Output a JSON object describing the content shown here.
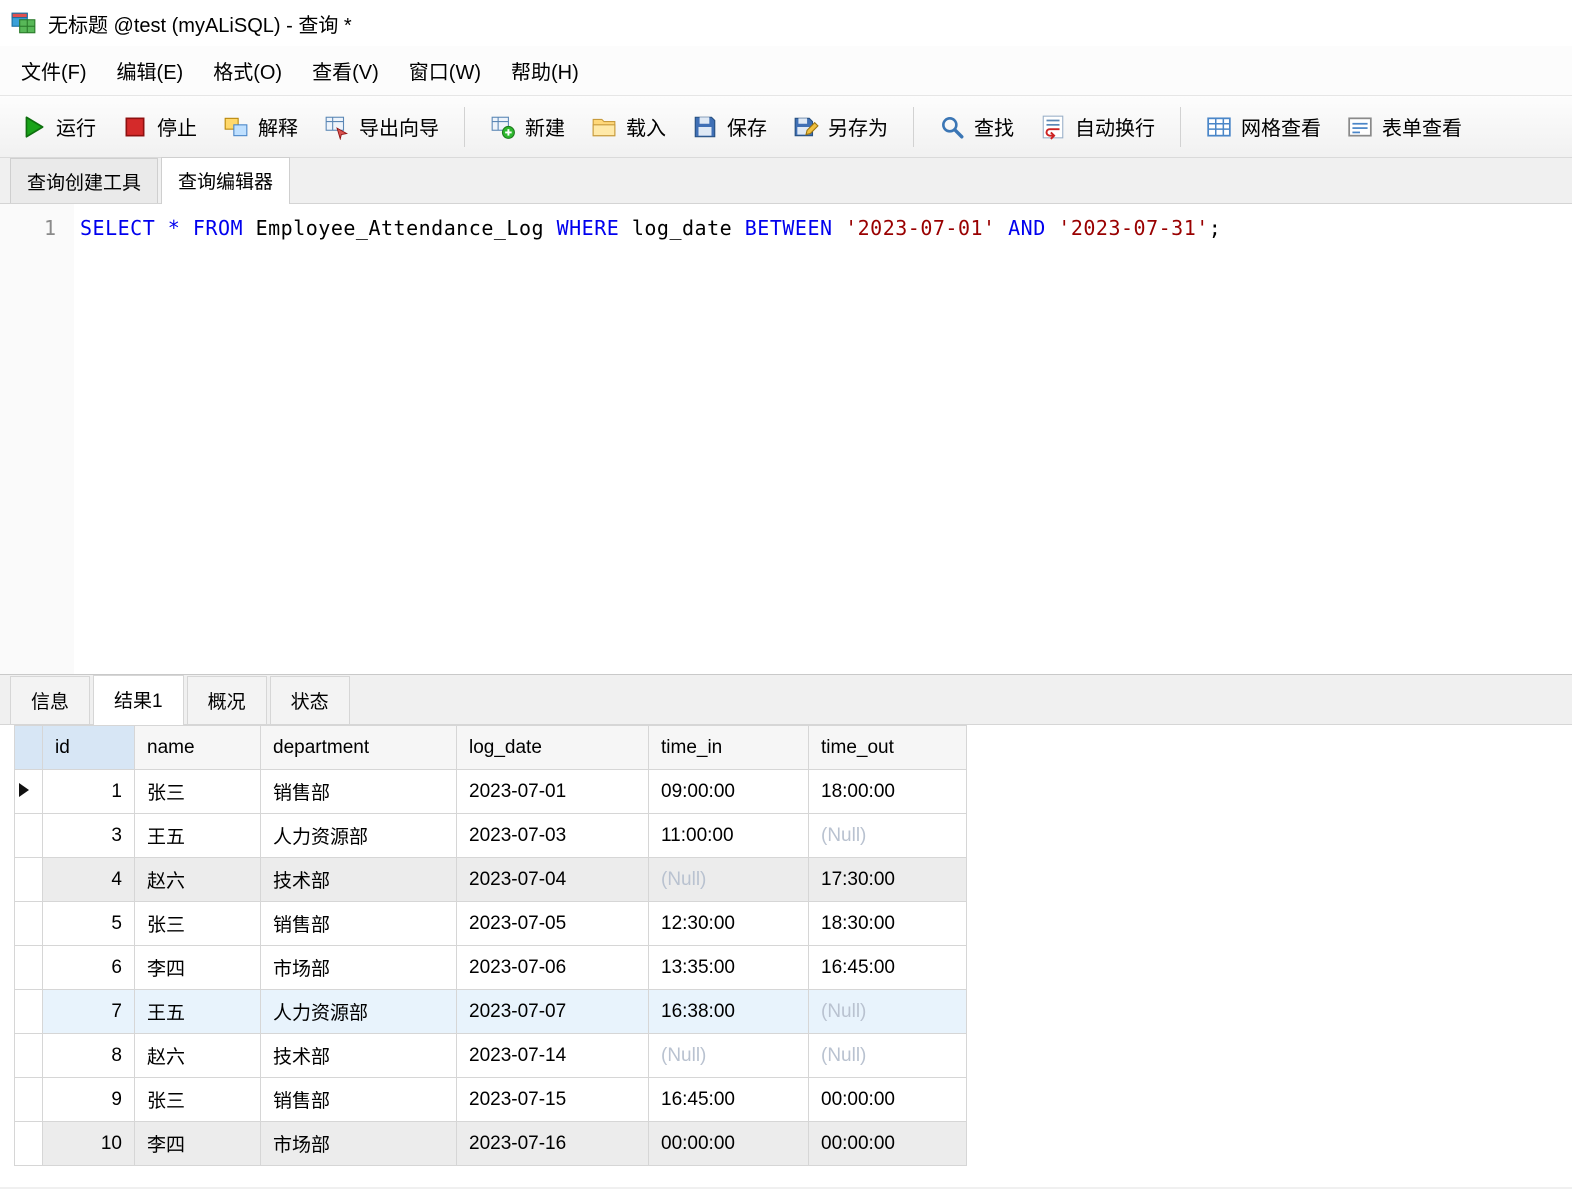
{
  "window": {
    "title": "无标题 @test (myALiSQL) - 查询 *"
  },
  "menubar": {
    "items": [
      {
        "key": "file",
        "label": "文件(F)"
      },
      {
        "key": "edit",
        "label": "编辑(E)"
      },
      {
        "key": "format",
        "label": "格式(O)"
      },
      {
        "key": "view",
        "label": "查看(V)"
      },
      {
        "key": "window",
        "label": "窗口(W)"
      },
      {
        "key": "help",
        "label": "帮助(H)"
      }
    ]
  },
  "toolbar": {
    "groups": [
      {
        "buttons": [
          {
            "key": "run",
            "label": "运行",
            "icon": "run-icon"
          },
          {
            "key": "stop",
            "label": "停止",
            "icon": "stop-icon"
          },
          {
            "key": "explain",
            "label": "解释",
            "icon": "explain-icon"
          },
          {
            "key": "export-wizard",
            "label": "导出向导",
            "icon": "export-wizard-icon"
          }
        ]
      },
      {
        "buttons": [
          {
            "key": "new",
            "label": "新建",
            "icon": "new-icon"
          },
          {
            "key": "load",
            "label": "载入",
            "icon": "load-icon"
          },
          {
            "key": "save",
            "label": "保存",
            "icon": "save-icon"
          },
          {
            "key": "save-as",
            "label": "另存为",
            "icon": "save-as-icon"
          }
        ]
      },
      {
        "buttons": [
          {
            "key": "find",
            "label": "查找",
            "icon": "find-icon"
          },
          {
            "key": "word-wrap",
            "label": "自动换行",
            "icon": "word-wrap-icon"
          }
        ]
      },
      {
        "buttons": [
          {
            "key": "grid-view",
            "label": "网格查看",
            "icon": "grid-view-icon"
          },
          {
            "key": "form-view",
            "label": "表单查看",
            "icon": "form-view-icon"
          }
        ]
      }
    ]
  },
  "query_tabs": [
    {
      "key": "query-builder",
      "label": "查询创建工具",
      "active": false
    },
    {
      "key": "query-editor",
      "label": "查询编辑器",
      "active": true
    }
  ],
  "editor": {
    "line_number": "1",
    "tokens": [
      {
        "type": "kw",
        "text": "SELECT"
      },
      {
        "type": "plain",
        "text": " "
      },
      {
        "type": "kw",
        "text": "*"
      },
      {
        "type": "plain",
        "text": " "
      },
      {
        "type": "kw",
        "text": "FROM"
      },
      {
        "type": "plain",
        "text": " Employee_Attendance_Log "
      },
      {
        "type": "kw",
        "text": "WHERE"
      },
      {
        "type": "plain",
        "text": " log_date "
      },
      {
        "type": "kw",
        "text": "BETWEEN"
      },
      {
        "type": "plain",
        "text": " "
      },
      {
        "type": "str",
        "text": "'2023-07-01'"
      },
      {
        "type": "plain",
        "text": " "
      },
      {
        "type": "kw",
        "text": "AND"
      },
      {
        "type": "plain",
        "text": " "
      },
      {
        "type": "str",
        "text": "'2023-07-31'"
      },
      {
        "type": "plain",
        "text": ";"
      }
    ]
  },
  "result_tabs": [
    {
      "key": "info",
      "label": "信息",
      "active": false
    },
    {
      "key": "result1",
      "label": "结果1",
      "active": true
    },
    {
      "key": "profile",
      "label": "概况",
      "active": false
    },
    {
      "key": "status",
      "label": "状态",
      "active": false
    }
  ],
  "grid": {
    "null_text": "(Null)",
    "columns": [
      {
        "key": "id",
        "label": "id",
        "align": "right"
      },
      {
        "key": "name",
        "label": "name",
        "align": "left"
      },
      {
        "key": "department",
        "label": "department",
        "align": "left"
      },
      {
        "key": "log_date",
        "label": "log_date",
        "align": "left"
      },
      {
        "key": "time_in",
        "label": "time_in",
        "align": "left"
      },
      {
        "key": "time_out",
        "label": "time_out",
        "align": "left"
      }
    ],
    "rows": [
      {
        "cells": [
          "1",
          "张三",
          "销售部",
          "2023-07-01",
          "09:00:00",
          "18:00:00"
        ],
        "current": true,
        "bg": "white"
      },
      {
        "cells": [
          "3",
          "王五",
          "人力资源部",
          "2023-07-03",
          "11:00:00",
          "(Null)"
        ],
        "current": false,
        "bg": "white"
      },
      {
        "cells": [
          "4",
          "赵六",
          "技术部",
          "2023-07-04",
          "(Null)",
          "17:30:00"
        ],
        "current": false,
        "bg": "gray"
      },
      {
        "cells": [
          "5",
          "张三",
          "销售部",
          "2023-07-05",
          "12:30:00",
          "18:30:00"
        ],
        "current": false,
        "bg": "white"
      },
      {
        "cells": [
          "6",
          "李四",
          "市场部",
          "2023-07-06",
          "13:35:00",
          "16:45:00"
        ],
        "current": false,
        "bg": "white"
      },
      {
        "cells": [
          "7",
          "王五",
          "人力资源部",
          "2023-07-07",
          "16:38:00",
          "(Null)"
        ],
        "current": false,
        "bg": "blue"
      },
      {
        "cells": [
          "8",
          "赵六",
          "技术部",
          "2023-07-14",
          "(Null)",
          "(Null)"
        ],
        "current": false,
        "bg": "white"
      },
      {
        "cells": [
          "9",
          "张三",
          "销售部",
          "2023-07-15",
          "16:45:00",
          "00:00:00"
        ],
        "current": false,
        "bg": "white"
      },
      {
        "cells": [
          "10",
          "李四",
          "市场部",
          "2023-07-16",
          "00:00:00",
          "00:00:00"
        ],
        "current": false,
        "bg": "gray"
      }
    ]
  },
  "colors": {
    "keyword": "#0000ee",
    "string": "#990000",
    "null_text": "#b9c2d0",
    "run_green": "#19a319",
    "stop_red": "#d42a2a"
  }
}
